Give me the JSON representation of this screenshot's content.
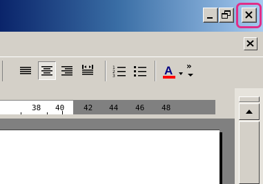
{
  "titlebar": {
    "accent": "#0a246a",
    "buttons": [
      {
        "name": "minimize-icon"
      },
      {
        "name": "restore-icon"
      },
      {
        "name": "close-icon",
        "highlight_color": "#e02d88"
      }
    ]
  },
  "menubar": {
    "document_close": {
      "name": "close-icon"
    }
  },
  "toolbar": {
    "buttons": [
      {
        "name": "align-left-icon"
      },
      {
        "name": "align-center-icon",
        "pressed": true
      },
      {
        "name": "align-right-icon"
      },
      {
        "name": "justify-icon"
      },
      {
        "name": "numbered-list-icon"
      },
      {
        "name": "bulleted-list-icon"
      },
      {
        "name": "font-color-icon",
        "glyph": "A",
        "color": "#ff0000"
      },
      {
        "name": "dropdown-arrow-icon"
      },
      {
        "name": "more-buttons-icon",
        "glyph": "»"
      }
    ]
  },
  "ruler": {
    "numbers": [
      "38",
      "40",
      "42",
      "44",
      "46",
      "48"
    ]
  },
  "scrollbar": {
    "up_button": {
      "name": "scroll-up-arrow-icon"
    }
  }
}
